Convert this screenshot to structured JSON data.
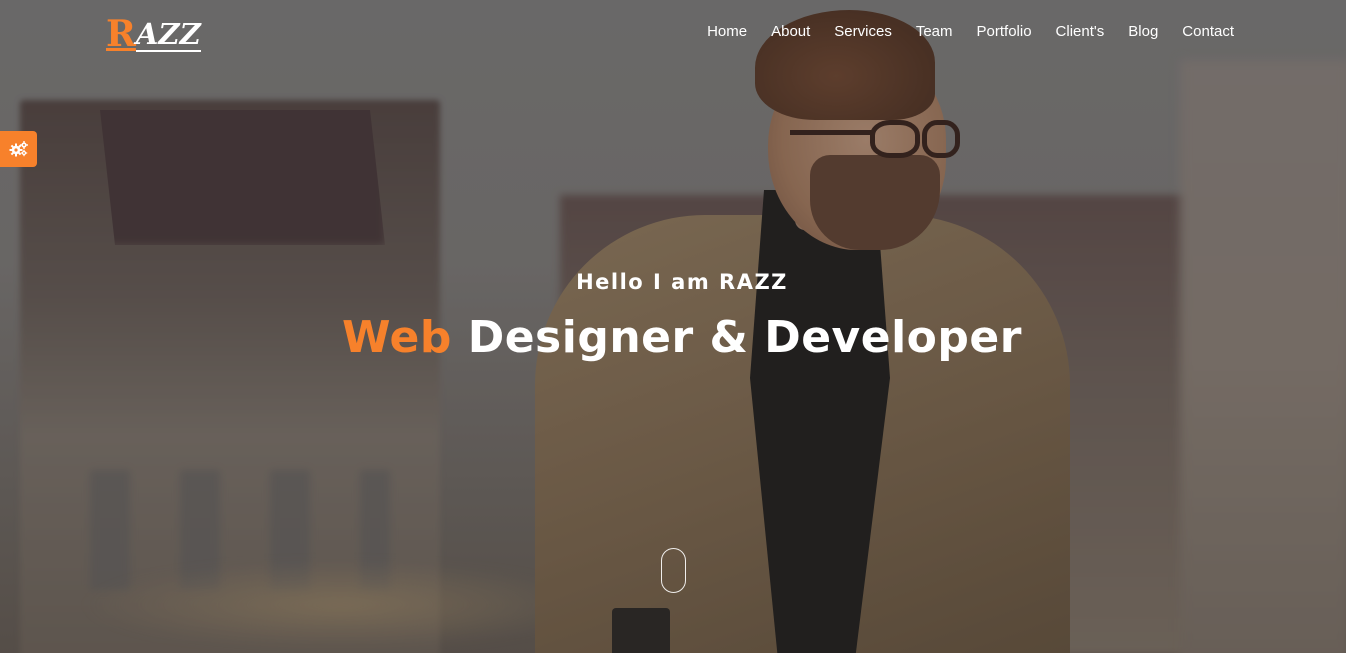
{
  "brand": {
    "logo_first": "R",
    "logo_rest": "AZZ",
    "accent_color": "#f7812b"
  },
  "nav": {
    "items": [
      "Home",
      "About",
      "Services",
      "Team",
      "Portfolio",
      "Client's",
      "Blog",
      "Contact"
    ]
  },
  "settings": {
    "icon": "gears-icon"
  },
  "hero": {
    "greeting": "Hello I am RAZZ",
    "headline_accent": "Web",
    "headline_rest": "Designer & Developer"
  },
  "scroll": {
    "icon": "mouse-scroll-icon"
  }
}
